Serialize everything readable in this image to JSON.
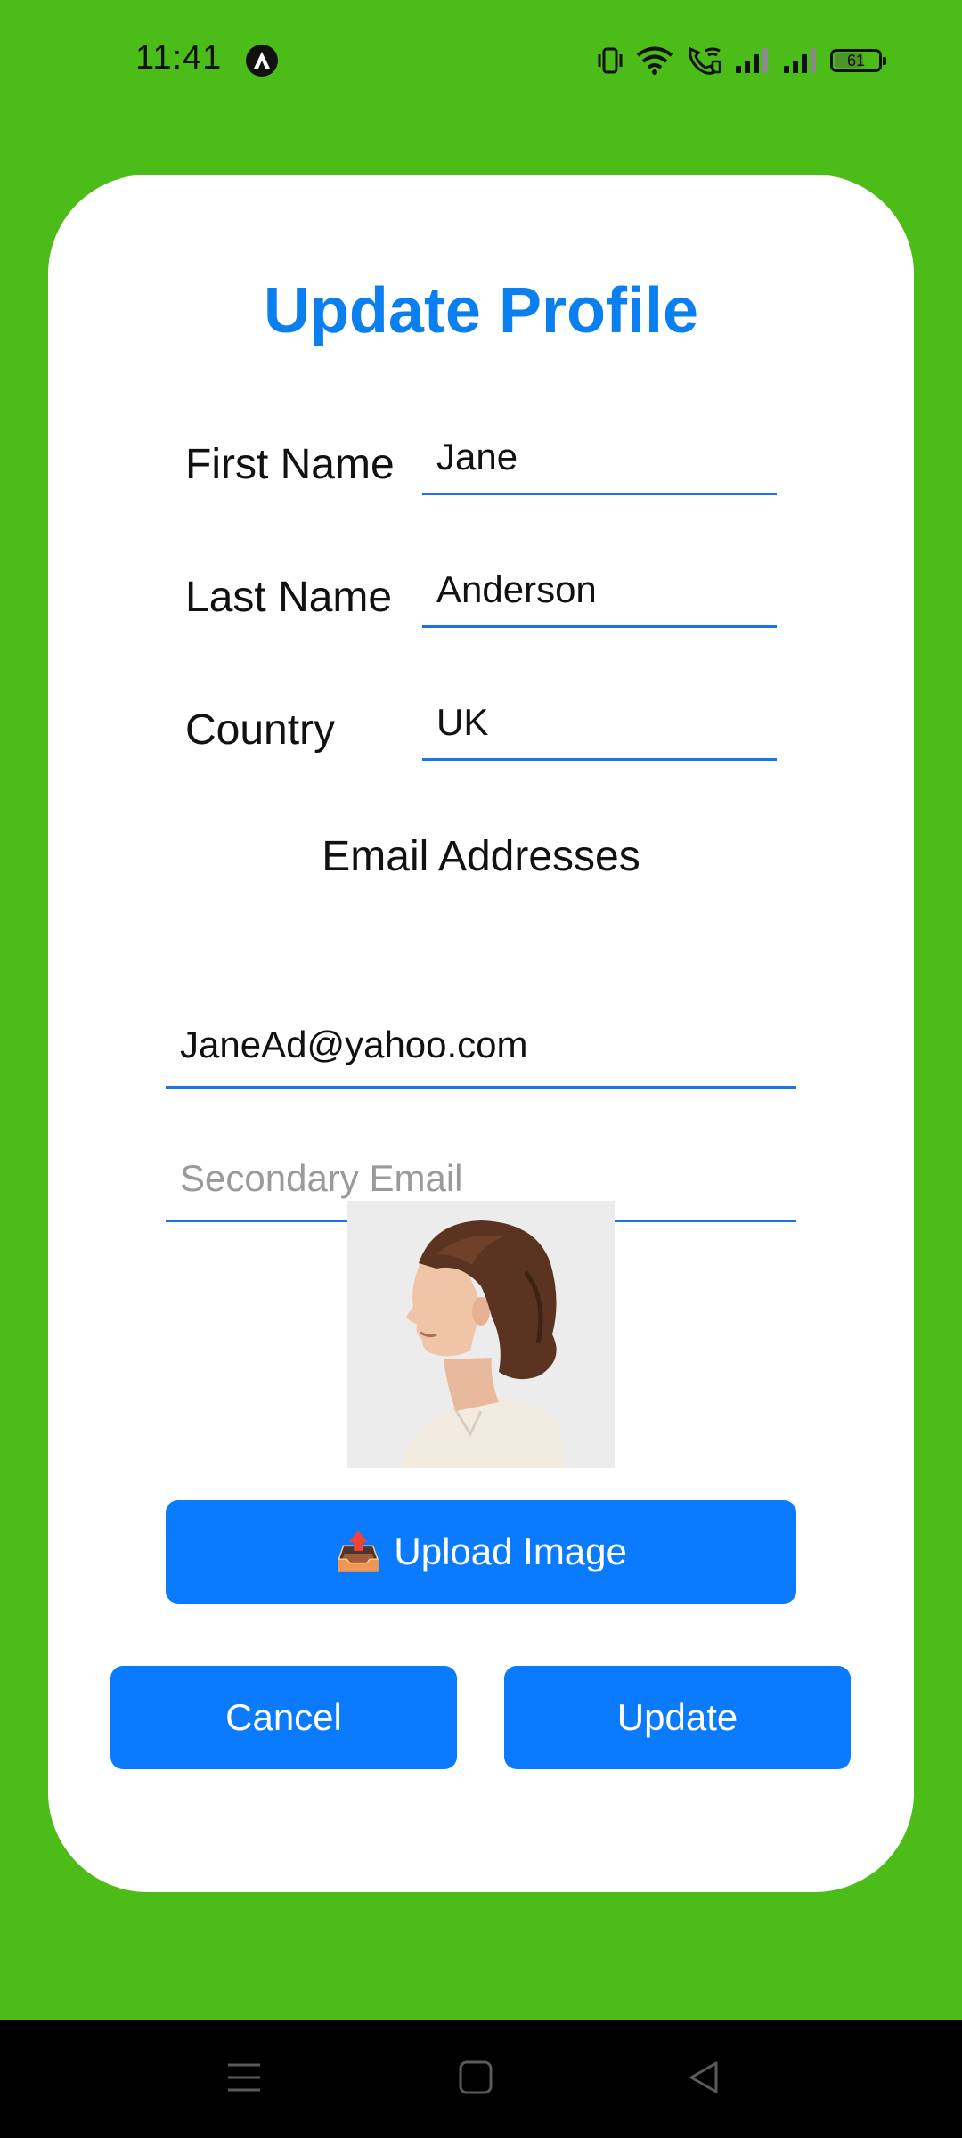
{
  "status_bar": {
    "time": "11:41",
    "battery_level": "61",
    "app_icon": "triangle-a-icon",
    "icons": [
      "vibrate-icon",
      "wifi-icon",
      "wifi-calling-icon",
      "signal-icon",
      "signal-icon",
      "battery-icon"
    ]
  },
  "form": {
    "title": "Update Profile",
    "first_name": {
      "label": "First Name",
      "value": "Jane"
    },
    "last_name": {
      "label": "Last Name",
      "value": "Anderson"
    },
    "country": {
      "label": "Country",
      "value": "UK"
    },
    "email_section_title": "Email Addresses",
    "primary_email": {
      "value": "JaneAd@yahoo.com"
    },
    "secondary_email": {
      "value": "",
      "placeholder": "Secondary Email"
    },
    "upload_button": {
      "icon": "📤",
      "label": "Upload Image"
    },
    "cancel_button": "Cancel",
    "update_button": "Update"
  },
  "nav_bar": {
    "items": [
      "menu-icon",
      "home-square-icon",
      "back-triangle-icon"
    ]
  },
  "colors": {
    "background": "#4cbc19",
    "accent": "#0a7aff",
    "title": "#0a7ff0",
    "underline": "#1a73e8"
  }
}
